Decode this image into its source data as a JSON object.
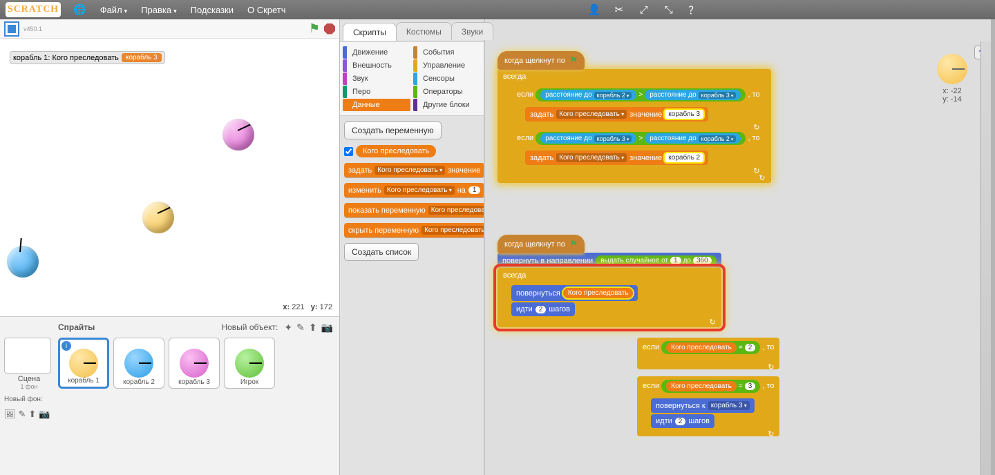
{
  "menu": {
    "logo": "SCRATCH",
    "file": "Файл",
    "edit": "Правка",
    "tips": "Подсказки",
    "about": "О Скретч"
  },
  "stage": {
    "version": "v450.1",
    "var_label": "корабль 1: Кого преследовать",
    "var_value": "корабль 3",
    "coord_x_label": "x:",
    "coord_x": "221",
    "coord_y_label": "y:",
    "coord_y": "172",
    "hint_x_label": "x:",
    "hint_x": "-22",
    "hint_y_label": "y:",
    "hint_y": "-14"
  },
  "spritepanel": {
    "title": "Спрайты",
    "new_object": "Новый объект:",
    "scene": "Сцена",
    "scene_sub": "1 фон",
    "new_backdrop": "Новый фон:",
    "sprites": [
      "корабль 1",
      "корабль 2",
      "корабль 3",
      "Игрок"
    ]
  },
  "tabs": {
    "scripts": "Скрипты",
    "costumes": "Костюмы",
    "sounds": "Звуки"
  },
  "categories": {
    "motion": "Движение",
    "looks": "Внешность",
    "sound": "Звук",
    "pen": "Перо",
    "data": "Данные",
    "events": "События",
    "control": "Управление",
    "sensing": "Сенсоры",
    "ops": "Операторы",
    "more": "Другие блоки"
  },
  "palette": {
    "make_var": "Создать переменную",
    "var_name": "Кого преследовать",
    "set_lbl": "задать",
    "set_val": "значение",
    "change_lbl": "изменить",
    "change_by": "на",
    "change_n": "1",
    "show_lbl": "показать переменную",
    "hide_lbl": "скрыть переменную",
    "make_list": "Создать список"
  },
  "blocks": {
    "when_flag": "когда щелкнут по",
    "forever": "всегда",
    "if": "если",
    "then": ", то",
    "distance_to": "расстояние до",
    "ship2": "корабль 2",
    "ship3": "корабль 3",
    "gt": ">",
    "set": "задать",
    "value": "значение",
    "var": "Кого преследовать",
    "val_ship3": "корабль 3",
    "val_ship2": "корабль 2",
    "point_dir": "повернуть в направлении",
    "rand": "выдать случайное от",
    "rand_to": "до",
    "r1": "1",
    "r360": "360",
    "point_towards": "повернуться",
    "point_towards_k": "повернуться к",
    "move": "идти",
    "steps": "шагов",
    "move_n": "2",
    "eq": "=",
    "eq2": "2",
    "eq3": "3"
  }
}
